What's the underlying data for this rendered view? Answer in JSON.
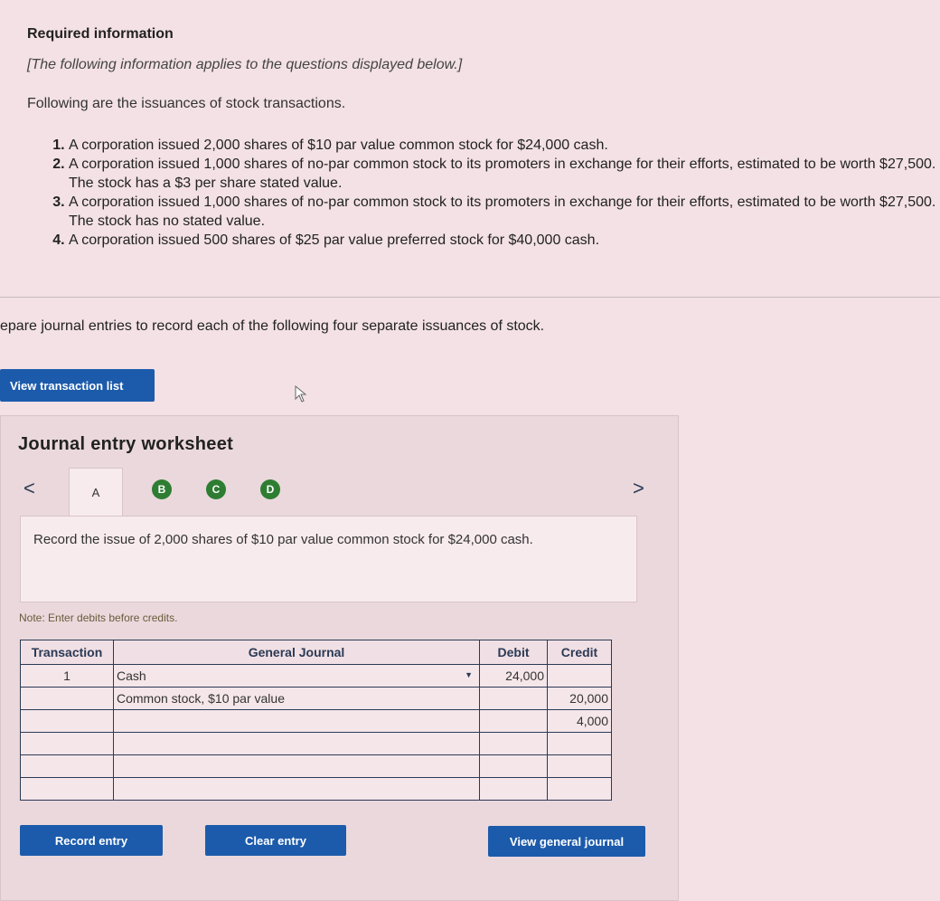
{
  "header": {
    "title": "Required information",
    "note": "[The following information applies to the questions displayed below.]",
    "intro": "Following are the issuances of stock transactions."
  },
  "transactions": [
    "A corporation issued 2,000 shares of $10 par value common stock for $24,000 cash.",
    "A corporation issued 1,000 shares of no-par common stock to its promoters in exchange for their efforts, estimated to be worth $27,500. The stock has a $3 per share stated value.",
    "A corporation issued 1,000 shares of no-par common stock to its promoters in exchange for their efforts, estimated to be worth $27,500. The stock has no stated value.",
    "A corporation issued 500 shares of $25 par value preferred stock for $40,000 cash."
  ],
  "prompt": "epare journal entries to record each of the following four separate issuances of stock.",
  "buttons": {
    "view_transaction_list": "View transaction list",
    "record_entry": "Record entry",
    "clear_entry": "Clear entry",
    "view_general_journal": "View general journal"
  },
  "worksheet": {
    "title": "Journal entry worksheet",
    "prev": "<",
    "next": ">",
    "tabs": [
      "A",
      "B",
      "C",
      "D"
    ],
    "active_tab": "A",
    "description": "Record the issue of 2,000 shares of $10 par value common stock for $24,000 cash.",
    "note": "Note: Enter debits before credits."
  },
  "journal": {
    "headers": {
      "transaction": "Transaction",
      "general_journal": "General Journal",
      "debit": "Debit",
      "credit": "Credit"
    },
    "rows": [
      {
        "transaction": "1",
        "account": "Cash",
        "debit": "24,000",
        "credit": ""
      },
      {
        "transaction": "",
        "account": "Common stock, $10 par value",
        "debit": "",
        "credit": "20,000"
      },
      {
        "transaction": "",
        "account": "",
        "debit": "",
        "credit": "4,000"
      },
      {
        "transaction": "",
        "account": "",
        "debit": "",
        "credit": ""
      },
      {
        "transaction": "",
        "account": "",
        "debit": "",
        "credit": ""
      },
      {
        "transaction": "",
        "account": "",
        "debit": "",
        "credit": ""
      }
    ]
  },
  "colors": {
    "primary_button": "#1c5bab",
    "tab_completed": "#2e7d32",
    "background": "#f3e1e5"
  }
}
